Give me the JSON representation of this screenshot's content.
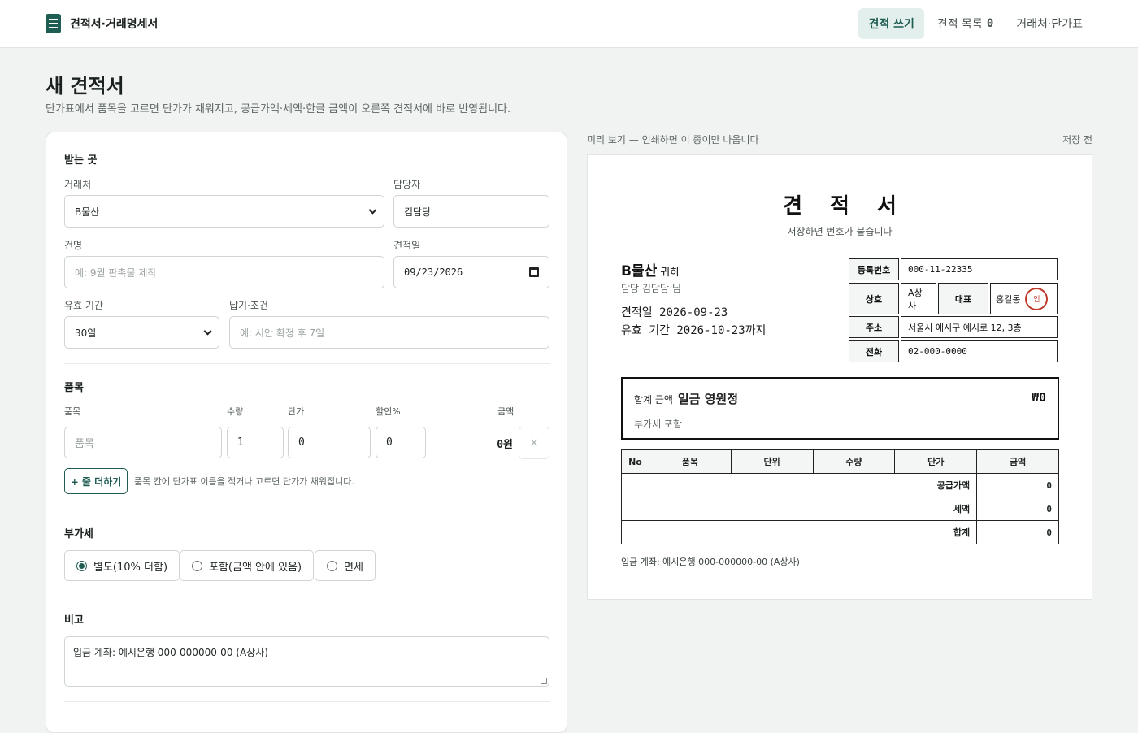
{
  "app": {
    "title": "견적서·거래명세서"
  },
  "nav": {
    "items": [
      {
        "label": "견적 쓰기"
      },
      {
        "label": "견적 목록",
        "count": "0"
      },
      {
        "label": "거래처·단가표"
      }
    ]
  },
  "page": {
    "title": "새 견적서",
    "subtitle": "단가표에서 품목을 고르면 단가가 채워지고, 공급가액·세액·한글 금액이 오른쪽 견적서에 바로 반영됩니다."
  },
  "form": {
    "recipient": {
      "section": "받는 곳",
      "client_label": "거래처",
      "client_value": "B물산",
      "manager_label": "담당자",
      "manager_value": "김담당",
      "subject_label": "건명",
      "subject_placeholder": "예: 9월 판촉물 제작",
      "date_label": "견적일",
      "date_value": "09/23/2026",
      "validity_label": "유효 기간",
      "validity_value": "30일",
      "terms_label": "납기·조건",
      "terms_placeholder": "예: 시안 확정 후 7일"
    },
    "items": {
      "section": "품목",
      "headers": {
        "item": "품목",
        "qty": "수량",
        "price": "단가",
        "discount": "할인%",
        "amount": "금액"
      },
      "rows": [
        {
          "item_placeholder": "품목",
          "qty": "1",
          "price": "0",
          "discount": "0",
          "amount": "0원",
          "remove": "×"
        }
      ],
      "add_label": "+ 줄 더하기",
      "hint": "품목 칸에 단가표 이름을 적거나 고르면 단가가 채워집니다."
    },
    "vat": {
      "section": "부가세",
      "options": [
        {
          "label": "별도(10% 더함)",
          "selected": true
        },
        {
          "label": "포함(금액 안에 있음)",
          "selected": false
        },
        {
          "label": "면세",
          "selected": false
        }
      ]
    },
    "notes": {
      "section": "비고",
      "value": "입금 계좌: 예시은행 000-000000-00 (A상사)"
    }
  },
  "preview": {
    "caption": "미리 보기 — 인쇄하면 이 종이만 나옵니다",
    "status": "저장 전",
    "doc": {
      "title": "견적서",
      "number_note": "저장하면 번호가 붙습니다",
      "customer": "B물산",
      "customer_suffix": "귀하",
      "contact": "담당 김담당 님",
      "date_line": "견적일 2026-09-23",
      "valid_line": "유효 기간 2026-10-23까지",
      "supplier": {
        "reg_label": "등록번호",
        "reg_value": "000-11-22335",
        "name_label": "상호",
        "name_value": "A상사",
        "rep_label": "대표",
        "rep_value": "홍길동",
        "stamp": "인",
        "addr_label": "주소",
        "addr_value": "서울시 예시구 예시로 12, 3층",
        "tel_label": "전화",
        "tel_value": "02-000-0000"
      },
      "total": {
        "label": "합계 금액",
        "korean": "일금 영원정",
        "amount": "₩0",
        "vat_note": "부가세 포함"
      },
      "table": {
        "headers": [
          "No",
          "품목",
          "단위",
          "수량",
          "단가",
          "금액"
        ],
        "summary": [
          {
            "label": "공급가액",
            "value": "0"
          },
          {
            "label": "세액",
            "value": "0"
          },
          {
            "label": "합계",
            "value": "0"
          }
        ]
      },
      "bank": "입금 계좌: 예시은행 000-000000-00 (A상사)"
    }
  },
  "colors": {
    "accent": "#1f5c52",
    "accent_bg": "#e3efec",
    "stamp": "#c0392b"
  }
}
